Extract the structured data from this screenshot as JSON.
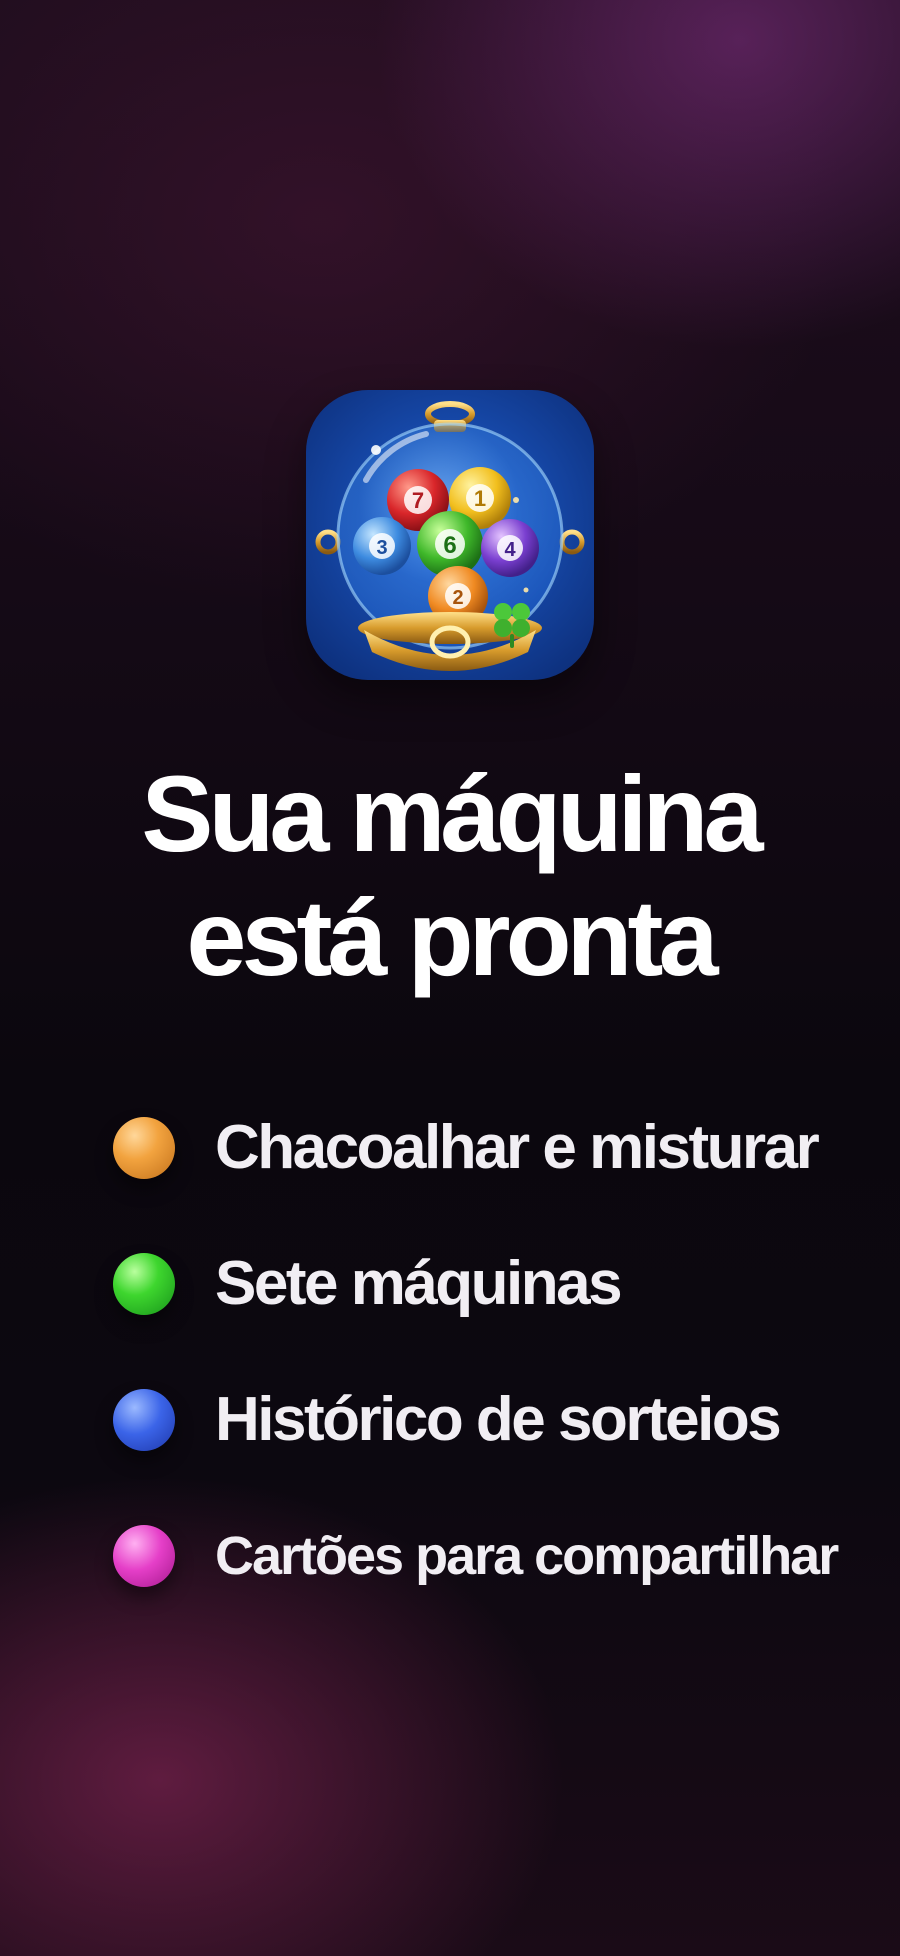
{
  "app_icon": {
    "name": "gumball-lottery-machine-icon",
    "balls": [
      "7",
      "1",
      "3",
      "6",
      "4",
      "2"
    ]
  },
  "headline": {
    "line1": "Sua máquina",
    "line2": "está pronta"
  },
  "features": [
    {
      "label": "Chacoalhar e misturar",
      "dot_color": "#f2a33f",
      "icon": "orange-ball-icon"
    },
    {
      "label": "Sete máquinas",
      "dot_color": "#3ed62e",
      "icon": "green-ball-icon"
    },
    {
      "label": "Histórico de sorteios",
      "dot_color": "#3b64e8",
      "icon": "blue-ball-icon"
    },
    {
      "label": "Cartões para compartilhar",
      "dot_color": "#e53fc8",
      "icon": "pink-ball-icon"
    }
  ],
  "colors": {
    "background_top": "#1e0d1d",
    "background_mid": "#0b070e",
    "background_glow": "#762c78",
    "text": "#ffffff"
  }
}
